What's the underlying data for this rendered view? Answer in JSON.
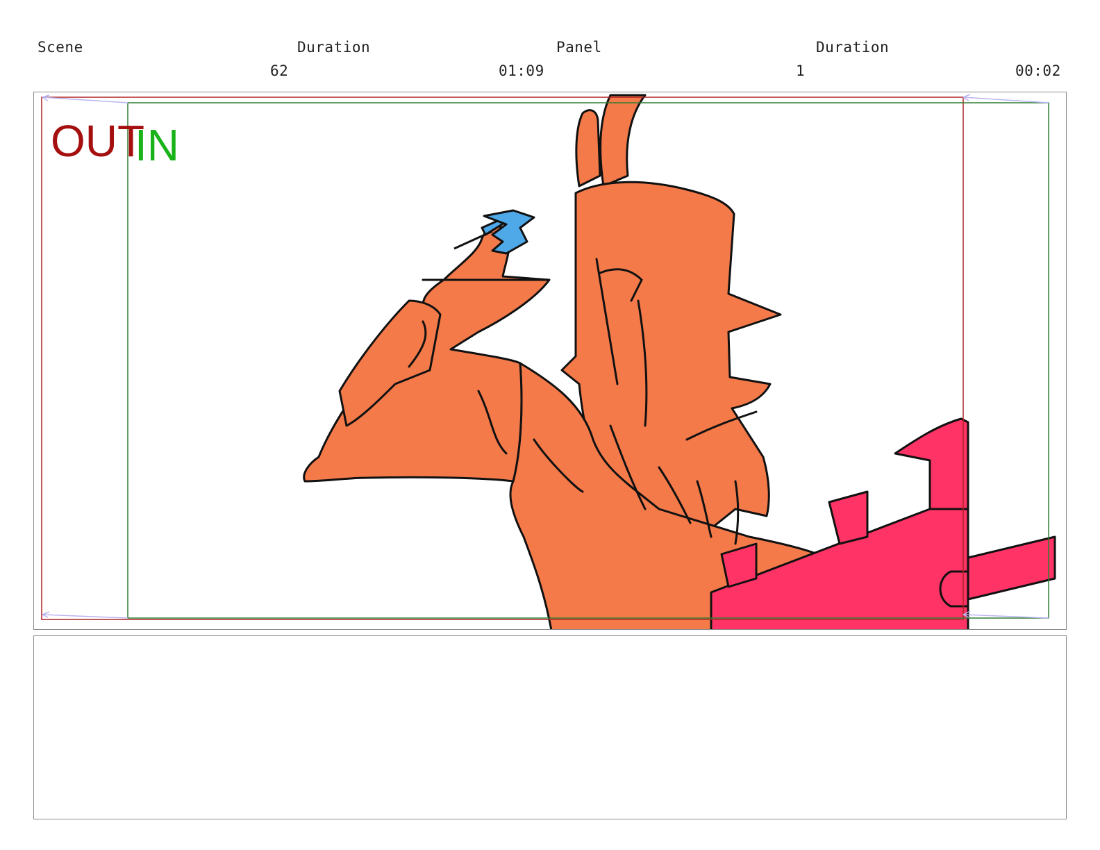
{
  "header": {
    "scene_label": "Scene",
    "scene_duration_label": "Duration",
    "panel_label": "Panel",
    "panel_duration_label": "Duration",
    "scene_value": "62",
    "scene_duration_value": "01:09",
    "panel_value": "1",
    "panel_duration_value": "00:02"
  },
  "panel": {
    "out_label": "OUT",
    "in_label": "IN",
    "colors": {
      "out_frame": "#b22222",
      "in_frame": "#2e7d32",
      "out_text": "#a50f0f",
      "in_text": "#19b219",
      "character_fill": "#f47a4a",
      "weapon_fill": "#ff3366",
      "prop_fill": "#4fa8e8",
      "line": "#111111"
    },
    "icons": [
      "camera-move-arrow-icon"
    ]
  },
  "notes": {
    "text": ""
  }
}
